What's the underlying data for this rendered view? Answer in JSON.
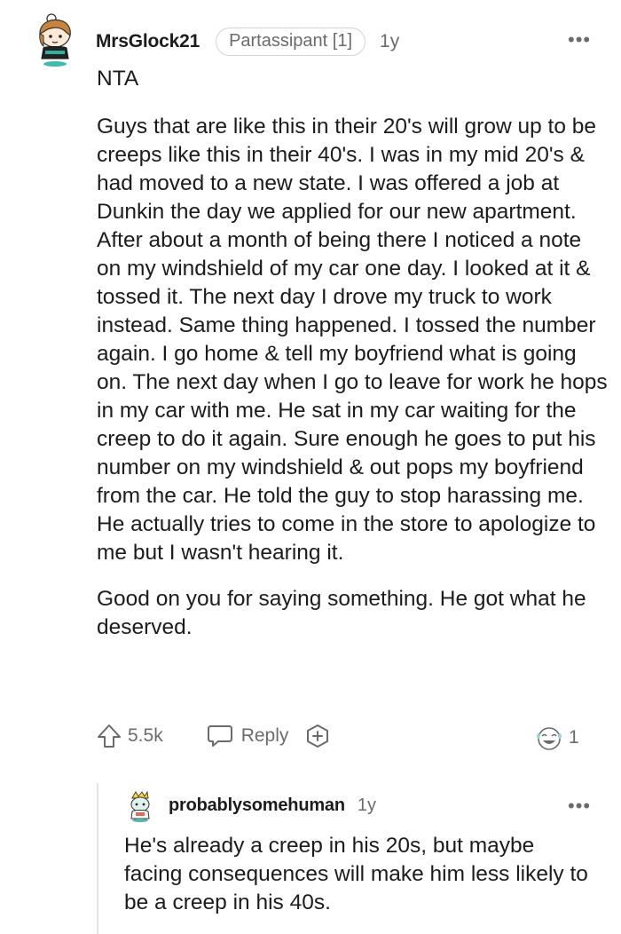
{
  "comment": {
    "username": "MrsGlock21",
    "flair": "Partassipant [1]",
    "age": "1y",
    "more_label": "•••",
    "paragraphs": [
      "NTA",
      "Guys that are like this in their 20's will grow up to be creeps like this in their 40's. I was in my mid 20's & had moved to a new state. I was offered a job at Dunkin the day we applied for our new apartment. After about a month of being there I noticed a note on my windshield of my car one day. I looked at it & tossed it. The next day I drove my truck to work instead. Same thing happened. I tossed the number again. I go home & tell my boyfriend what is going on. The next day when I go to leave for work he hops in my car with me. He sat in my car waiting for the creep to do it again. Sure enough he goes to put his number on my windshield & out pops my boyfriend from the car. He told the guy to stop harassing me. He actually tries to come in the store to apologize to me but I wasn't hearing it.",
      "Good on you for saying something. He got what he deserved."
    ],
    "actions": {
      "upvotes": "5.5k",
      "reply_label": "Reply",
      "award_count": "1"
    },
    "icons": {
      "upvote": "upvote-arrow-icon",
      "reply": "speech-bubble-icon",
      "award": "plus-award-icon",
      "award_received": "laughing-face-award-icon"
    }
  },
  "reply": {
    "username": "probablysomehuman",
    "age": "1y",
    "more_label": "•••",
    "text": "He's already a creep in his 20s, but maybe facing consequences will make him less likely to be a creep in his 40s."
  },
  "colors": {
    "text_primary": "#1c1c1c",
    "text_secondary": "#6b6b6b",
    "flair_border": "#d4d4d4",
    "thread_line": "#e4e4e4"
  }
}
